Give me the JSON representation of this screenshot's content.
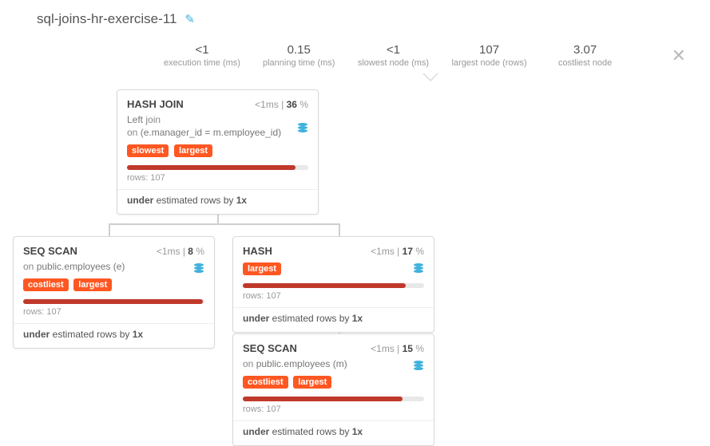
{
  "title": "sql-joins-hr-exercise-11",
  "stats": [
    {
      "value": "<1",
      "label": "execution time (ms)"
    },
    {
      "value": "0.15",
      "label": "planning time (ms)"
    },
    {
      "value": "<1",
      "label": "slowest node (ms)"
    },
    {
      "value": "107",
      "label": "largest node (rows)"
    },
    {
      "value": "3.07",
      "label": "costliest node"
    }
  ],
  "nodes": {
    "hashjoin": {
      "name": "HASH JOIN",
      "time": "<1ms",
      "pct": "36",
      "sub1": "Left",
      "sub1b": "join",
      "sub2a": "on",
      "sub2b": "(e.manager_id = m.employee_id)",
      "tags": [
        "slowest",
        "largest"
      ],
      "bar": 93,
      "rows": "rows: 107",
      "est_pre": "under",
      "est_mid": " estimated rows by ",
      "est_x": "1x"
    },
    "seq1": {
      "name": "SEQ SCAN",
      "time": "<1ms",
      "pct": "8",
      "suba": "on",
      "subb": "public.employees (e)",
      "tags": [
        "costliest",
        "largest"
      ],
      "bar": 99,
      "rows": "rows: 107",
      "est_pre": "under",
      "est_mid": " estimated rows by ",
      "est_x": "1x"
    },
    "hash": {
      "name": "HASH",
      "time": "<1ms",
      "pct": "17",
      "tags": [
        "largest"
      ],
      "bar": 90,
      "rows": "rows: 107",
      "est_pre": "under",
      "est_mid": " estimated rows by ",
      "est_x": "1x"
    },
    "seq2": {
      "name": "SEQ SCAN",
      "time": "<1ms",
      "pct": "15",
      "suba": "on",
      "subb": "public.employees (m)",
      "tags": [
        "costliest",
        "largest"
      ],
      "bar": 88,
      "rows": "rows: 107",
      "est_pre": "under",
      "est_mid": " estimated rows by ",
      "est_x": "1x"
    }
  }
}
